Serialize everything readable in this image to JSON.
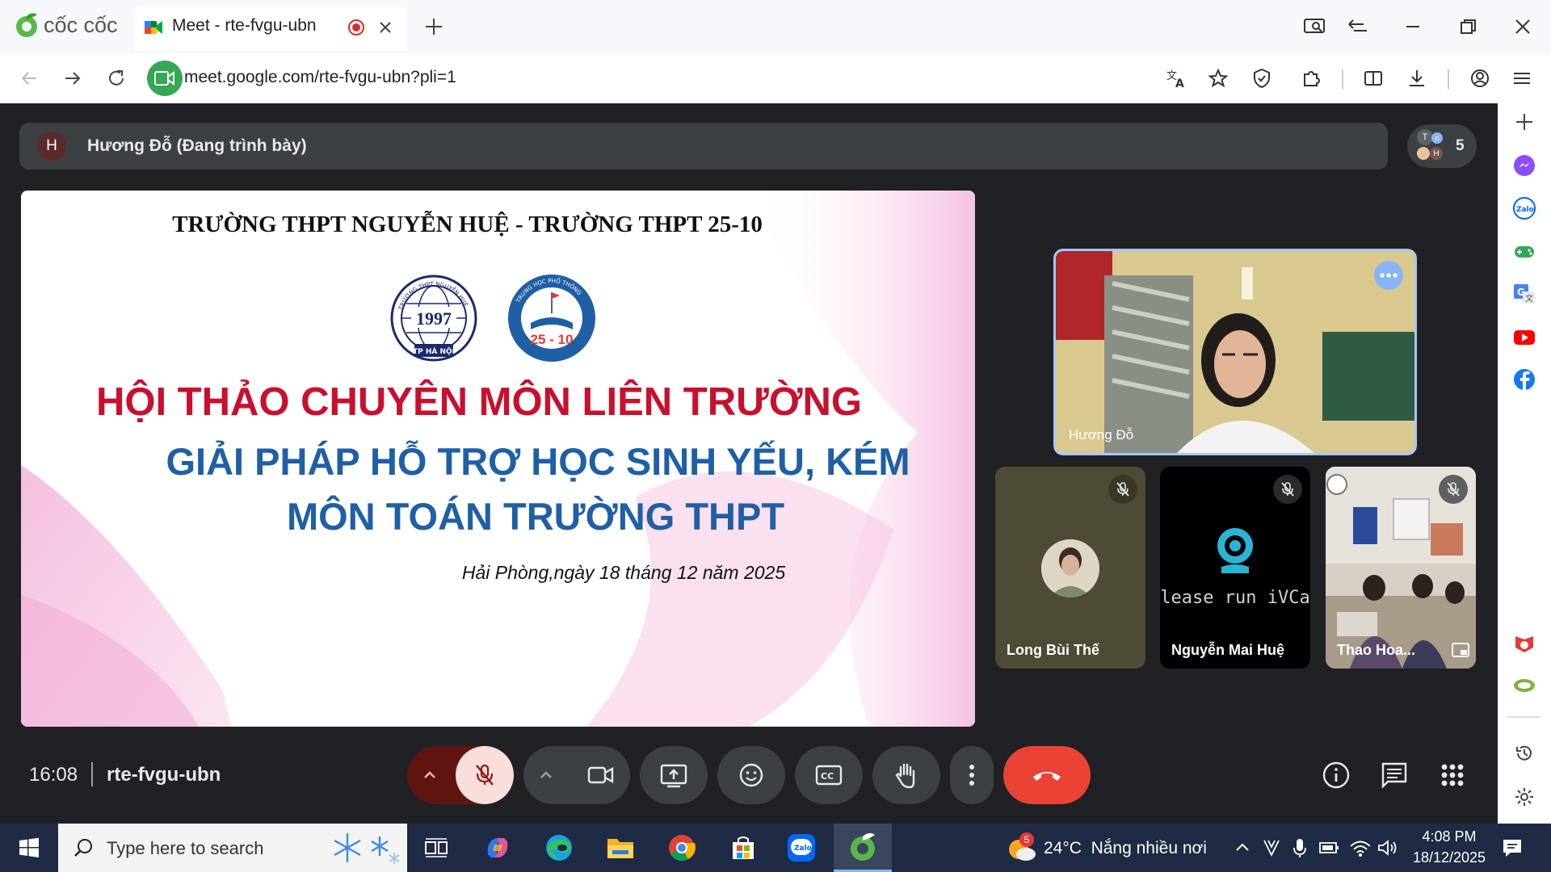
{
  "browser": {
    "brand": "cốc cốc",
    "tab_title": "Meet - rte-fvgu-ubn",
    "url": "meet.google.com/rte-fvgu-ubn?pli=1"
  },
  "meet": {
    "presenter_initial": "H",
    "presenter_label": "Hương Đỗ (Đang trình bày)",
    "participant_count": "5",
    "people_avatars": [
      "T",
      "n",
      "H"
    ],
    "time": "16:08",
    "meeting_code": "rte-fvgu-ubn"
  },
  "slide": {
    "school_header": "TRƯỜNG THPT NGUYỄN HUỆ - TRƯỜNG THPT 25-10",
    "logo1_text_top": "TRƯỜNG THPT NGUYỄN HUỆ",
    "logo1_year": "1997",
    "logo1_text_bottom": "TP HÀ NỘI",
    "logo2_text_top": "TRUNG HỌC PHỔ THÔNG",
    "logo2_number": "25 - 10",
    "title_red": "HỘI THẢO CHUYÊN MÔN LIÊN TRƯỜNG",
    "title_blue_1": "GIẢI PHÁP HỖ TRỢ HỌC SINH YẾU, KÉM",
    "title_blue_2": "MÔN TOÁN TRƯỜNG THPT",
    "date_line": "Hải Phòng,ngày 18 tháng 12 năm 2025"
  },
  "tiles": [
    {
      "name": "Hương Đỗ"
    },
    {
      "name": "Long Bùi Thế"
    },
    {
      "name": "Nguyễn Mai Huệ",
      "overlay": "Please run iVCam"
    },
    {
      "name": "Thao Hoa..."
    }
  ],
  "taskbar": {
    "search_placeholder": "Type here to search",
    "weather_badge": "5",
    "weather": "24°C  Nắng nhiều nơi",
    "clock_time": "4:08 PM",
    "clock_date": "18/12/2025"
  },
  "colors": {
    "end_call": "#ea4335",
    "mic_off_bg": "#f9dedc",
    "mic_off_icon": "#8c1d18",
    "slide_red": "#c8102e",
    "slide_blue": "#1f5fa6"
  }
}
